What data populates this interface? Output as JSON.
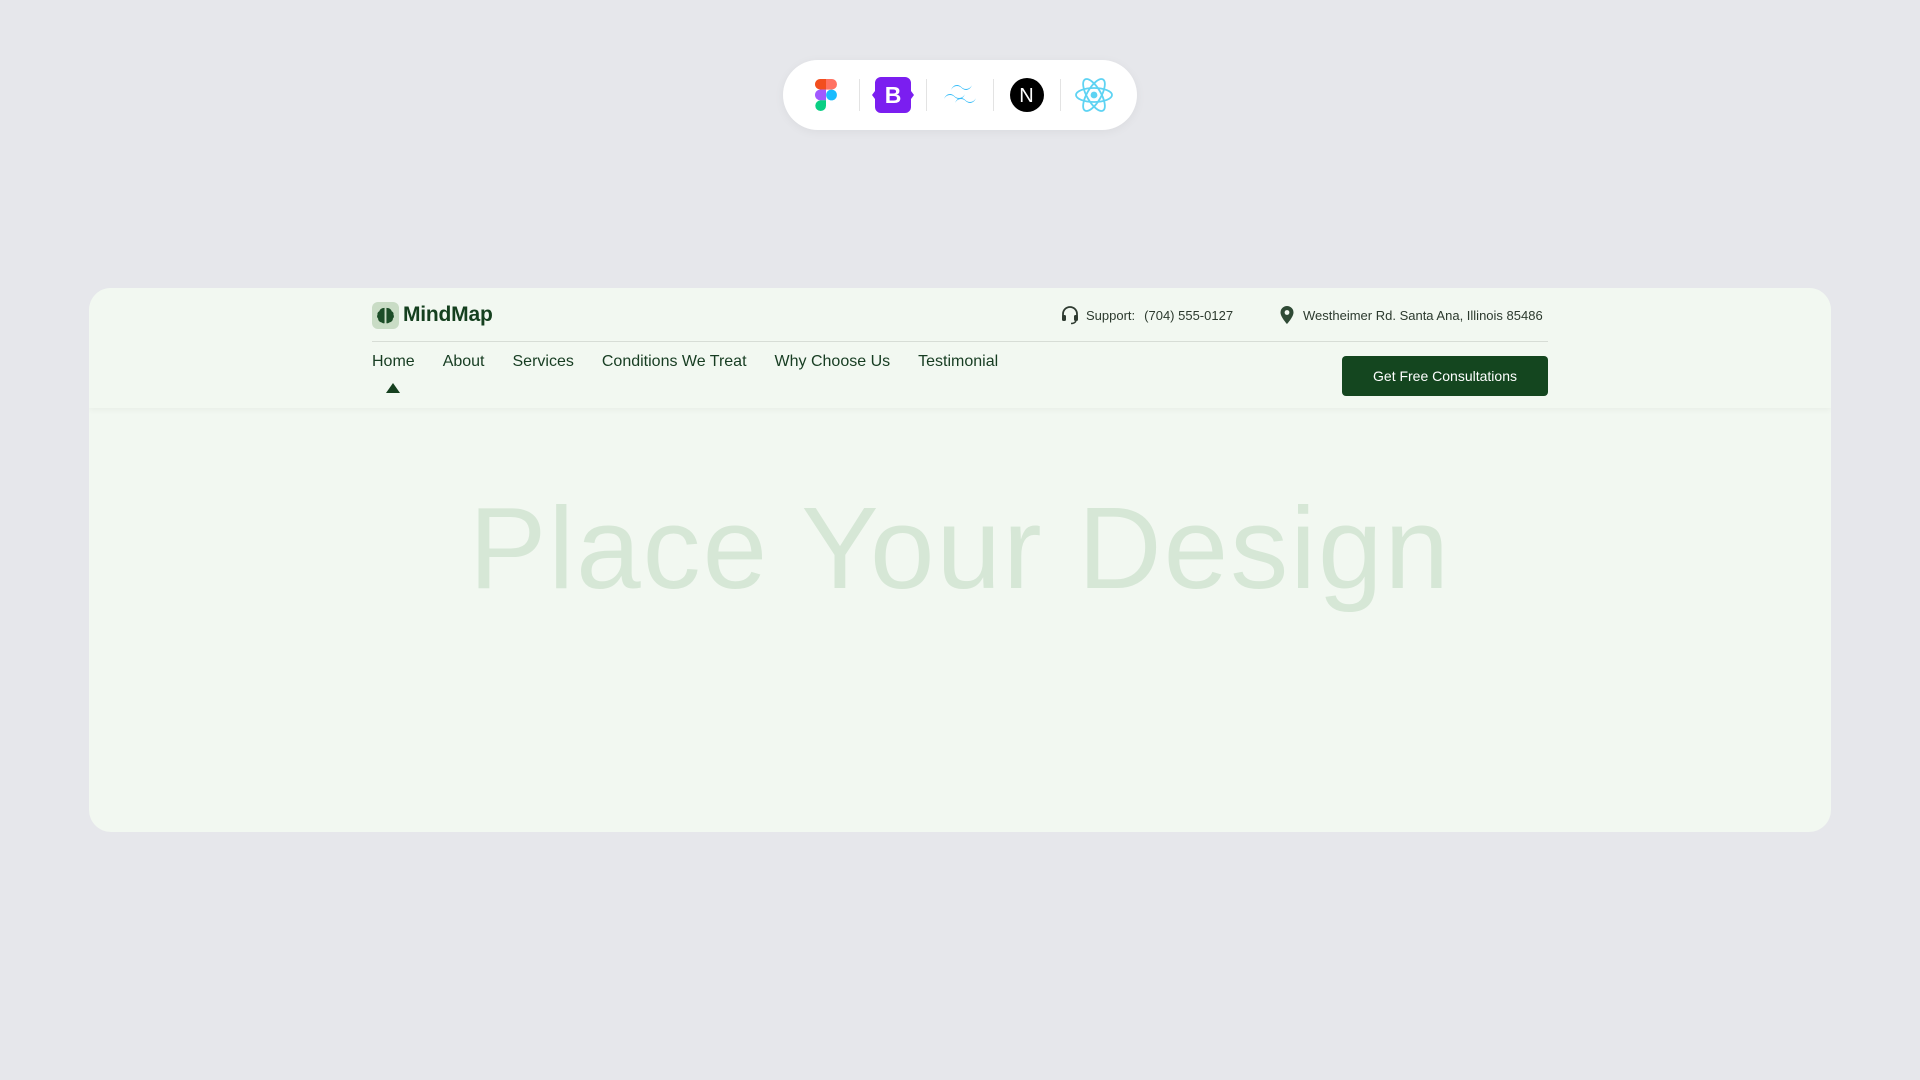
{
  "tech_badges": [
    {
      "name": "figma",
      "icon": "figma-icon"
    },
    {
      "name": "bootstrap",
      "icon": "bootstrap-icon",
      "letter": "B",
      "color": "#7b1ef0"
    },
    {
      "name": "tailwind",
      "icon": "tailwind-icon",
      "color": "#38bdf8"
    },
    {
      "name": "nextjs",
      "icon": "nextjs-icon",
      "letter": "N",
      "color": "#000000"
    },
    {
      "name": "react",
      "icon": "react-icon",
      "color": "#5ed3f3"
    }
  ],
  "brand": {
    "name": "MindMap",
    "icon": "brain-icon"
  },
  "topbar": {
    "support_label": "Support:",
    "support_phone": "(704) 555-0127",
    "support_icon": "headset-icon",
    "address": "Westheimer Rd. Santa Ana, Illinois 85486",
    "address_icon": "location-pin-icon"
  },
  "nav": {
    "items": [
      {
        "label": "Home",
        "active": true
      },
      {
        "label": "About"
      },
      {
        "label": "Services"
      },
      {
        "label": "Conditions We Treat"
      },
      {
        "label": "Why Choose Us"
      },
      {
        "label": "Testimonial"
      }
    ]
  },
  "cta": {
    "label": "Get Free Consultations"
  },
  "hero": {
    "placeholder": "Place Your Design"
  },
  "colors": {
    "page_bg": "#e6e7eb",
    "card_bg": "#f2f8f1",
    "brand_green": "#14461f",
    "placeholder_text": "#d6e7d6"
  }
}
